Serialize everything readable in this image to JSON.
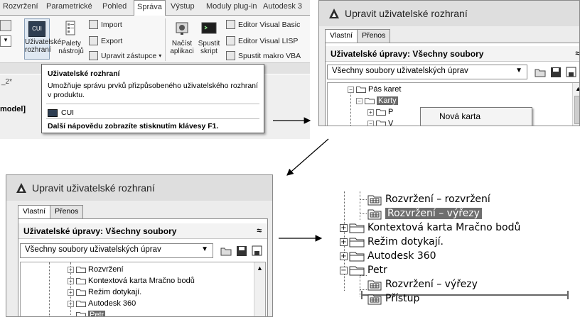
{
  "ribbon": {
    "tabs": [
      "Rozvržení",
      "Parametrické",
      "Pohled",
      "Správa",
      "Výstup",
      "Moduly plug-in",
      "Autodesk 3"
    ],
    "active_tab": "Správa",
    "buttons": {
      "cui_icon_text": "CUI",
      "cui_label_line1": "Uživatelské",
      "cui_label_line2": "rozhraní",
      "palettes_line1": "Palety",
      "palettes_line2": "nástrojů",
      "import": "Import",
      "export": "Export",
      "edit_aliases": "Upravit zástupce",
      "load_app_line1": "Načíst",
      "load_app_line2": "aplikaci",
      "run_script_line1": "Spustit",
      "run_script_line2": "skript",
      "vba_editor": "Editor Visual Basic",
      "lisp_editor": "Editor Visual LISP",
      "run_vba": "Spustit makro VBA"
    },
    "left_fragment_1": "_2*",
    "left_fragment_2": "model]",
    "tooltip": {
      "title": "Uživatelské rozhraní",
      "description": "Umožňuje správu prvků přizpůsobeného uživatelského rozhraní v produktu.",
      "command": "CUI",
      "help": "Další nápovědu zobrazíte stisknutím klávesy F1."
    }
  },
  "dialog": {
    "title": "Upravit uživatelské rozhraní",
    "tabs": [
      "Vlastní",
      "Přenos"
    ],
    "section_title": "Uživatelské úpravy: Všechny soubory",
    "collapse_glyph": "≈",
    "combo_value": "Všechny soubory uživatelských úprav"
  },
  "dialog_top_tree": [
    {
      "label": "Pás karet",
      "pm": "−"
    },
    {
      "label": "Karty",
      "pm": "−",
      "selected": true
    },
    {
      "label": "P",
      "pm": "+"
    },
    {
      "label": "V",
      "pm": "−"
    }
  ],
  "context_menu": {
    "item": "Nová karta"
  },
  "dialog_bottom_tree": [
    {
      "label": "Rozvržení",
      "pm": "+"
    },
    {
      "label": "Kontextová karta Mračno bodů",
      "pm": "+"
    },
    {
      "label": "Režim dotykají.",
      "pm": "+"
    },
    {
      "label": "Autodesk 360",
      "pm": "+"
    },
    {
      "label": "Petr",
      "pm": "",
      "selected": true
    }
  ],
  "enlarged_tree": [
    {
      "label": "Rozvržení – rozvržení",
      "kind": "tab"
    },
    {
      "label": "Rozvržení – výřezy",
      "kind": "tab",
      "selected": true
    },
    {
      "label": "Kontextová karta Mračno bodů",
      "kind": "folder",
      "pm": "+"
    },
    {
      "label": "Režim dotykají.",
      "kind": "folder",
      "pm": "+"
    },
    {
      "label": "Autodesk 360",
      "kind": "folder",
      "pm": "+"
    },
    {
      "label": "Petr",
      "kind": "folder",
      "pm": "−"
    },
    {
      "label": "Rozvržení – výřezy",
      "kind": "tab"
    },
    {
      "label": "Přístup",
      "kind": "tab"
    }
  ],
  "colors": {
    "selection": "#6a6a6a",
    "dialog_bg": "#ececec",
    "title_bg": "#dedede",
    "autocad_logo": "#2b2b2b"
  }
}
